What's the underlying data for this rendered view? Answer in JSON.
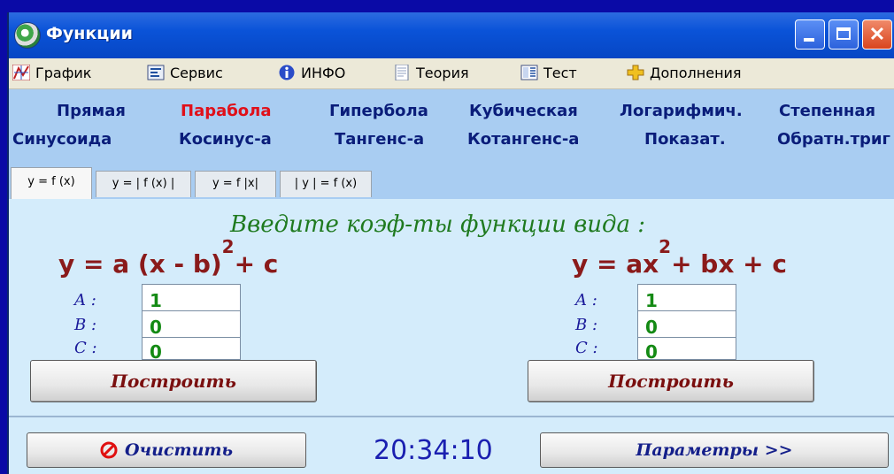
{
  "window": {
    "title": "Функции"
  },
  "menu": [
    {
      "label": "График",
      "icon": "chart-icon"
    },
    {
      "label": "Сервис",
      "icon": "service-icon"
    },
    {
      "label": "ИНФО",
      "icon": "info-icon"
    },
    {
      "label": "Теория",
      "icon": "theory-icon"
    },
    {
      "label": "Тест",
      "icon": "test-icon"
    },
    {
      "label": "Дополнения",
      "icon": "addons-icon"
    }
  ],
  "functions": {
    "row1": [
      "Прямая",
      "Парабола",
      "Гипербола",
      "Кубическая",
      "Логарифмич.",
      "Степенная"
    ],
    "row2": [
      "Синусоида",
      "Косинус-а",
      "Тангенс-а",
      "Котангенс-а",
      "Показат.",
      "Обратн.триг"
    ],
    "active": "Парабола"
  },
  "tabs": [
    "y = f (x)",
    "y = | f (x) |",
    "y = f |x|",
    "| y | = f (x)"
  ],
  "active_tab": "y = f (x)",
  "content": {
    "prompt": "Введите коэф-ты функции вида :",
    "left": {
      "formula_base": "y = a (x - b)",
      "formula_exp": "2",
      "formula_tail": "+ c",
      "labels": [
        "A :",
        "B :",
        "C :"
      ],
      "values": [
        "1",
        "0",
        "0"
      ],
      "button": "Построить"
    },
    "right": {
      "formula_base": "y = ax",
      "formula_exp": "2",
      "formula_tail": "+ bx + c",
      "labels": [
        "A :",
        "B :",
        "C :"
      ],
      "values": [
        "1",
        "0",
        "0"
      ],
      "button": "Построить"
    }
  },
  "bottom": {
    "clear_label": "Очистить",
    "clock": "20:34:10",
    "params_label": "Параметры >>"
  },
  "colors": {
    "desktop": "#0a0aa6",
    "titlebar": "#0a53d8",
    "content_bg": "#d4ecfb",
    "panel_bg": "#a9cdf2",
    "active_function": "#e0101a",
    "values": "#148a14"
  }
}
